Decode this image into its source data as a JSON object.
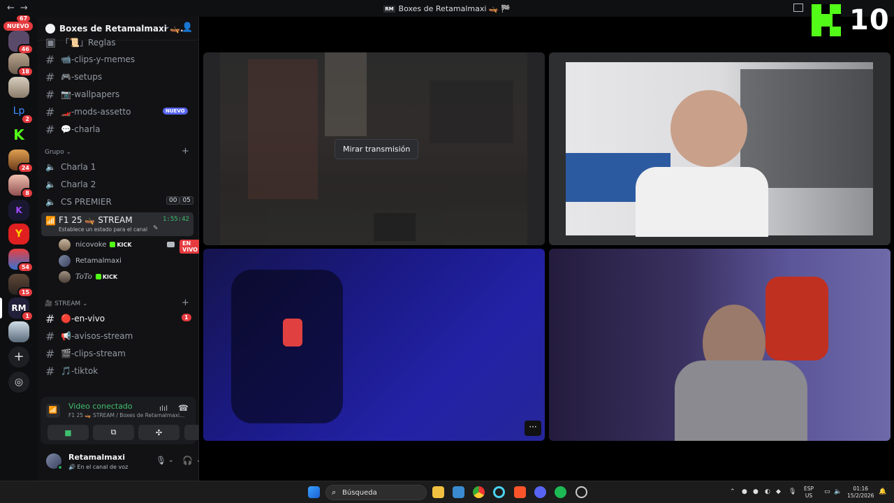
{
  "window": {
    "title": "Boxes de Retamalmaxi 🛶 🏁",
    "logo": "RM"
  },
  "guilds": {
    "top_count": "67",
    "nuevo_label": "NUEVO",
    "items": [
      {
        "badge": "46"
      },
      {
        "badge": "18"
      },
      {
        "badge": ""
      },
      {
        "badge": "2"
      },
      {
        "badge": ""
      },
      {
        "badge": "24"
      },
      {
        "badge": "8"
      },
      {
        "badge": ""
      },
      {
        "badge": ""
      },
      {
        "badge": "54"
      },
      {
        "badge": "15"
      },
      {
        "badge": "1"
      },
      {
        "badge": ""
      }
    ]
  },
  "server": {
    "name": "Boxes de Retamalmaxi 🛶..."
  },
  "text_channels": [
    {
      "label": "「📜」Reglas"
    },
    {
      "label": "📹-clips-y-memes"
    },
    {
      "label": "🎮-setups"
    },
    {
      "label": "📷-wallpapers"
    },
    {
      "label": "🏎️-mods-assetto",
      "badge": "NUEVO"
    },
    {
      "label": "💬-charla"
    }
  ],
  "category_grupo": "Grupo",
  "voice_channels": [
    {
      "label": "Charla 1"
    },
    {
      "label": "Charla 2"
    },
    {
      "label": "CS PREMIER",
      "user_count": "00",
      "user_limit": "05"
    }
  ],
  "active_voice": {
    "name": "F1 25 🛶 STREAM",
    "status": "Establece un estado para el canal",
    "time": "1:55:42",
    "members": [
      {
        "name": "nicovoke",
        "tag": "KICK",
        "live": "EN VIVO"
      },
      {
        "name": "Retamalmaxi",
        "tag": "",
        "live": ""
      },
      {
        "name": "ToTo",
        "tag": "KICK",
        "live": ""
      }
    ]
  },
  "category_stream": "STREAM",
  "stream_channels": [
    {
      "label": "🔴-en-vivo",
      "badge": "1"
    },
    {
      "label": "📢-avisos-stream"
    },
    {
      "label": "🎬-clips-stream"
    },
    {
      "label": "🎵-tiktok"
    }
  ],
  "voice_panel": {
    "title": "Video conectado",
    "subtitle": "F1 25 🛶 STREAM / Boxes de Retamalmaxi..."
  },
  "user_panel": {
    "name": "Retamalmaxi",
    "status": "En el canal de voz"
  },
  "stage": {
    "watch_button": "Mirar transmisión",
    "more_label": "···"
  },
  "kick_overlay": {
    "number": "10"
  },
  "taskbar": {
    "search_label": "Búsqueda",
    "lang_top": "ESP",
    "lang_bottom": "US",
    "time": "01:16",
    "date": "15/2/2026"
  },
  "colors": {
    "accent_green": "#3fbf6f",
    "kick_green": "#53fc18",
    "badge_red": "#e53b3f",
    "blurple": "#5865f2"
  }
}
